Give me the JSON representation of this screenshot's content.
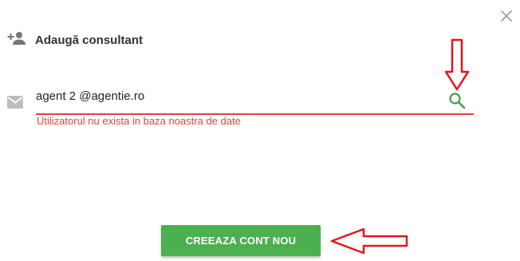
{
  "dialog": {
    "title": "Adaugă consultant",
    "close_icon": "close-icon",
    "header_icon": "person-add-icon"
  },
  "email": {
    "icon": "mail-icon",
    "value": "agent 2 @agentie.ro",
    "search_icon": "search-icon",
    "error": "Utilizatorul nu exista in baza noastra de date"
  },
  "actions": {
    "create_label": "CREEAZA CONT NOU"
  },
  "colors": {
    "accent_green": "#4caf50",
    "search_green": "#43a047",
    "error_red": "#e0443a",
    "annotation_red": "#e8131b",
    "icon_grey": "#757575"
  }
}
